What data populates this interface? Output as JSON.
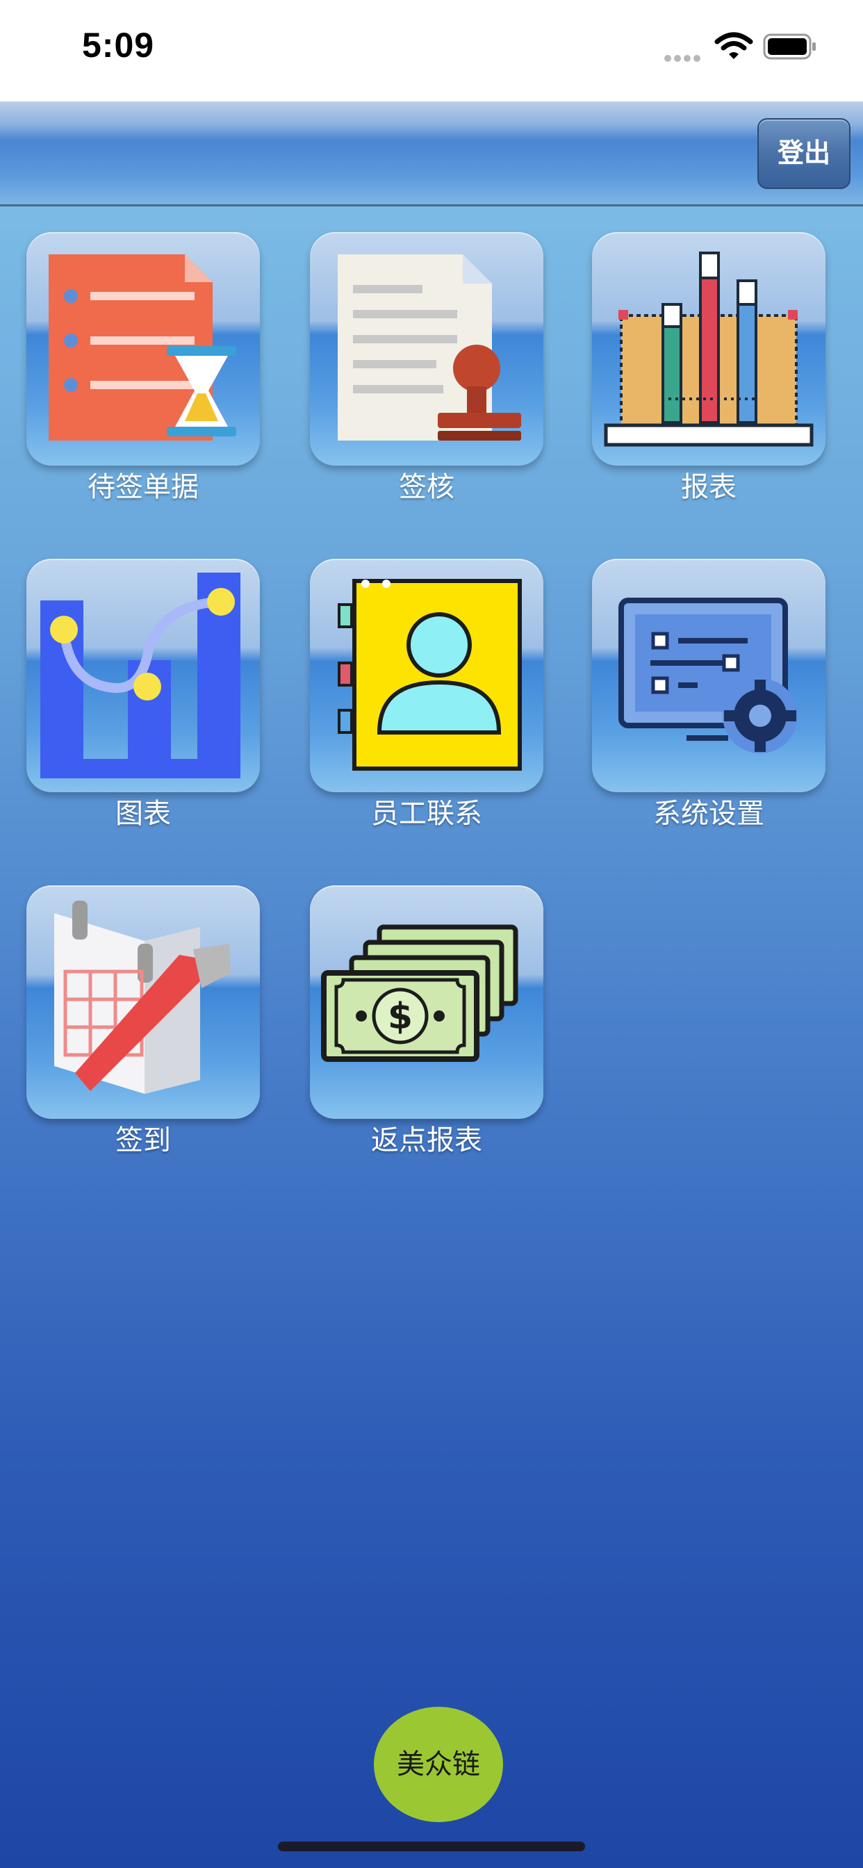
{
  "status_bar": {
    "time": "5:09"
  },
  "header": {
    "logout_label": "登出"
  },
  "menu": {
    "items": [
      {
        "label": "待签单据",
        "icon": "pending-documents-icon"
      },
      {
        "label": "签核",
        "icon": "approval-stamp-icon"
      },
      {
        "label": "报表",
        "icon": "report-bars-icon"
      },
      {
        "label": "图表",
        "icon": "chart-curve-icon"
      },
      {
        "label": "员工联系",
        "icon": "employee-contact-icon"
      },
      {
        "label": "系统设置",
        "icon": "settings-gear-icon"
      },
      {
        "label": "签到",
        "icon": "check-in-calendar-icon"
      },
      {
        "label": "返点报表",
        "icon": "cash-rebate-icon"
      }
    ]
  },
  "footer": {
    "brand_label": "美众链"
  },
  "colors": {
    "accent_green": "#9bc832",
    "background_top": "#84c6ea",
    "background_bottom": "#1e46a5"
  }
}
